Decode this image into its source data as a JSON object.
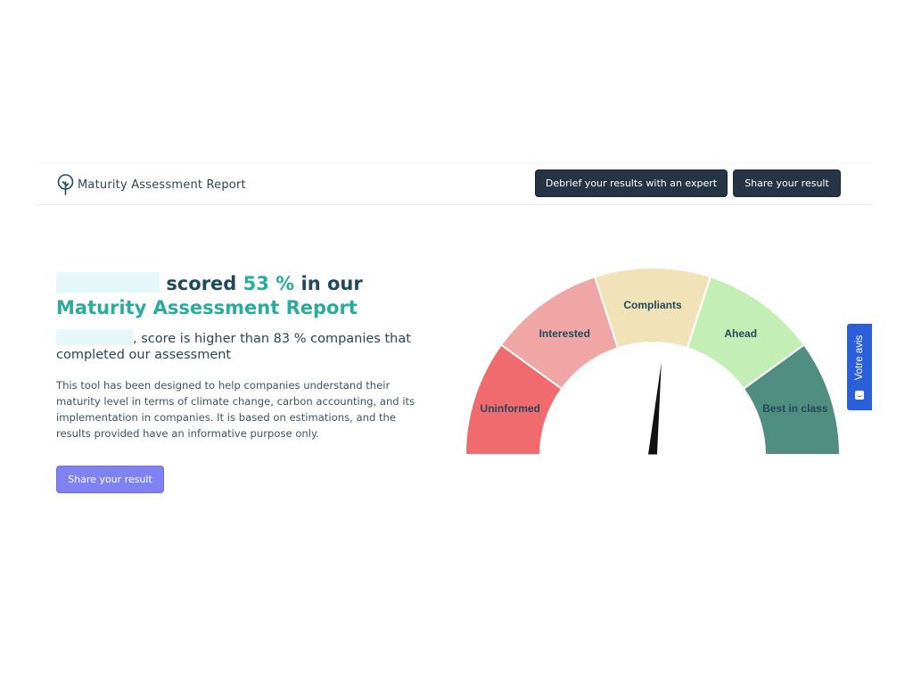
{
  "header": {
    "title": "Maturity Assessment Report",
    "logo_icon": "tree-icon",
    "buttons": {
      "debrief_label": "Debrief your results with an expert",
      "share_label": "Share your result"
    }
  },
  "hero": {
    "headline_part1": "scored",
    "score": "53 %",
    "headline_part2": "in our",
    "report_name": "Maturity Assessment Report",
    "comparison_part1": ", score is higher than",
    "comparison_percent": "83 %",
    "comparison_part2": "companies that completed our assessment",
    "description": "This tool has been designed to help companies understand their maturity level in terms of climate change, carbon accounting, and its implementation in companies. It is based on estimations, and the results provided have an informative purpose only.",
    "share_label": "Share your result"
  },
  "gauge": {
    "value_percent": 53,
    "segments": [
      {
        "label": "Uninformed",
        "color": "#f06b6d"
      },
      {
        "label": "Interested",
        "color": "#f0a6a4"
      },
      {
        "label": "Compliants",
        "color": "#f2e2b8"
      },
      {
        "label": "Ahead",
        "color": "#c3efb7"
      },
      {
        "label": "Best in class",
        "color": "#4f8e80"
      }
    ]
  },
  "feedback_tab": {
    "label": "Votre avis",
    "icon": "smiley-icon"
  },
  "colors": {
    "accent_teal": "#2aab9b",
    "dark_navy": "#1f4a5a",
    "button_dark": "#253545",
    "button_primary": "#7f83f1",
    "feedback_blue": "#2b5fd9"
  }
}
